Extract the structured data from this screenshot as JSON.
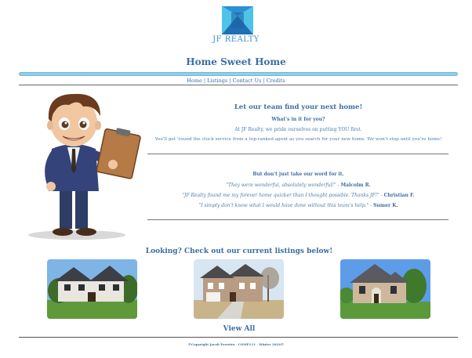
{
  "header": {
    "brand": "JF REALTY",
    "title": "Home Sweet Home"
  },
  "nav": {
    "items": [
      "Home",
      "Listings",
      "Contact Us",
      "Credits"
    ],
    "separator": " | "
  },
  "pitch": {
    "heading": "Let our team find your next home!",
    "subheading": "What's in it for you?",
    "line1": "At JF Realty, we pride ourselves on putting YOU first.",
    "line2": "You'll get 'round the clock service from a top-ranked agent as you search for your new home. We won't stop until you're home!"
  },
  "reviews": {
    "heading": "But don't just take our word for it.",
    "items": [
      {
        "quote": "\"They were wonderful, absolutely wonderful!\"",
        "dash": " - ",
        "author": "Malcolm R."
      },
      {
        "quote": "\"JF Realty found me my forever home quicker than I thought possible. Thanks JF!\"",
        "dash": " - ",
        "author": "Christian F."
      },
      {
        "quote": "\"I simply don't know what I would have done without this team's help.\"",
        "dash": " - ",
        "author": "Sumer K."
      }
    ]
  },
  "listings": {
    "heading": "Looking? Check out our current listings below!",
    "view_all": "View All"
  },
  "footer": {
    "text": "©Copyright Jacob Ferreira  ·  COMP111  ·  Winter 2024©"
  },
  "colors": {
    "accent": "#3a6ea5",
    "title_bar": "#8fd0ea",
    "logo_light": "#4fc3e8",
    "logo_dark": "#1f6fb3"
  }
}
